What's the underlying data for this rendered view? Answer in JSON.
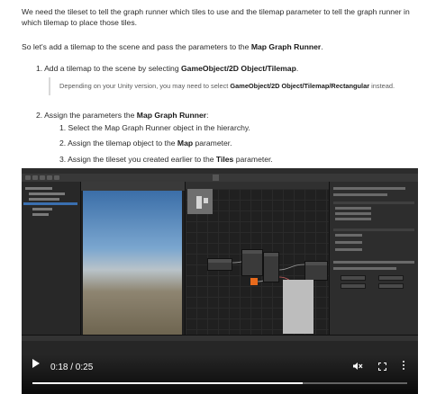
{
  "intro": {
    "text": "We need the tileset to tell the graph runner which tiles to use and the tilemap parameter to tell the graph runner in which tilemap to place those tiles."
  },
  "lead": {
    "before": "So let's add a tilemap to the scene and pass the parameters to the ",
    "bold": "Map Graph Runner",
    "after": "."
  },
  "step1": {
    "prefix": "1. Add a tilemap to the scene by selecting ",
    "bold": "GameObject/2D Object/Tilemap",
    "suffix": "."
  },
  "note": {
    "before": "Depending on your Unity version, you may need to select ",
    "bold": "GameObject/2D Object/Tilemap/Rectangular",
    "after": " instead."
  },
  "step2": {
    "prefix": "2. Assign the parameters the ",
    "bold": "Map Graph Runner",
    "suffix": ":"
  },
  "substeps": [
    {
      "prefix": "1. Select the Map Graph Runner object in the hierarchy.",
      "bold": "",
      "suffix": ""
    },
    {
      "prefix": "2. Assign the tilemap object to the ",
      "bold": "Map",
      "suffix": " parameter."
    },
    {
      "prefix": "3. Assign the tileset you created earlier to the ",
      "bold": "Tiles",
      "suffix": " parameter."
    }
  ],
  "video": {
    "time_label": "0:18 / 0:25",
    "progress": 0.72,
    "play_icon": "play-icon",
    "mute_icon": "volume-muted-icon",
    "fullscreen_icon": "fullscreen-icon",
    "more_icon": "more-vertical-icon"
  },
  "colors": {
    "orange_node": "#e86a1c",
    "selection": "#3a6fb0"
  }
}
